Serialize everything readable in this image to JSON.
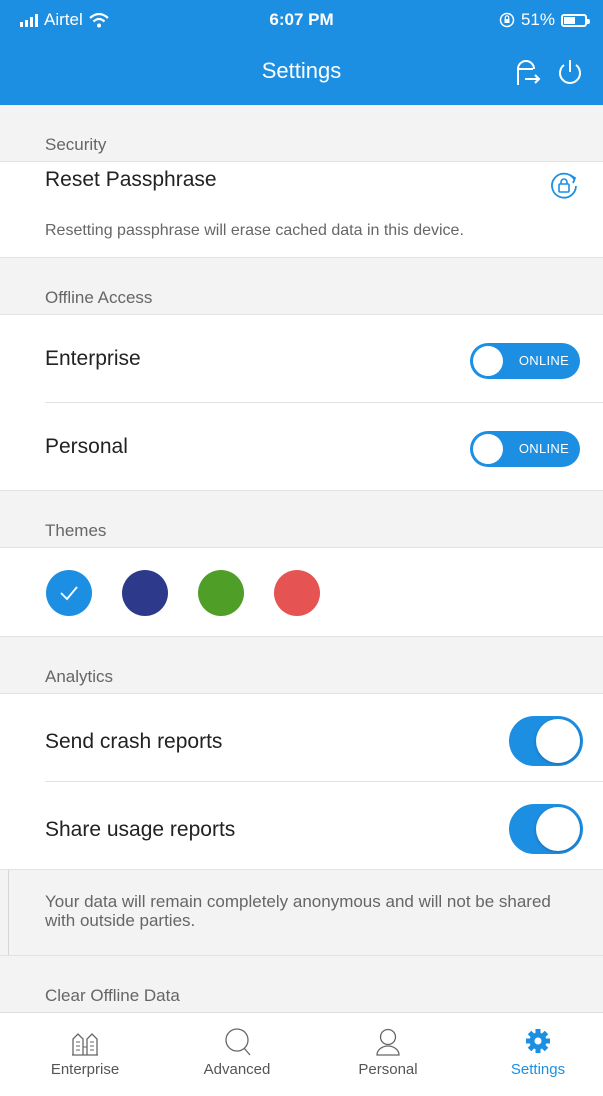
{
  "status_bar": {
    "carrier": "Airtel",
    "time": "6:07 PM",
    "battery": "51%",
    "battery_level": 0.51,
    "icons": [
      "signal-icon",
      "wifi-icon",
      "rotation-lock-icon",
      "battery-icon"
    ]
  },
  "nav": {
    "title": "Settings",
    "icons": [
      "switch-account-icon",
      "power-icon"
    ]
  },
  "security": {
    "header": "Security",
    "reset_label": "Reset Passphrase",
    "reset_icon": "reset-lock-icon",
    "reset_note": "Resetting passphrase will erase cached data in this device."
  },
  "offline_access": {
    "header": "Offline Access",
    "items": [
      {
        "label": "Enterprise",
        "toggle": "ONLINE"
      },
      {
        "label": "Personal",
        "toggle": "ONLINE"
      }
    ]
  },
  "themes": {
    "header": "Themes",
    "colors": [
      "#1d8fe3",
      "#2d3a8c",
      "#4e9e28",
      "#e65353"
    ],
    "selected": 0
  },
  "analytics": {
    "header": "Analytics",
    "items": [
      {
        "label": "Send crash reports",
        "on": true
      },
      {
        "label": "Share usage reports",
        "on": true
      }
    ],
    "note": "Your data will remain completely anonymous and will not be shared with outside parties."
  },
  "clear_offline": {
    "header": "Clear Offline Data"
  },
  "tabbar": {
    "tabs": [
      {
        "label": "Enterprise",
        "icon": "enterprise-icon"
      },
      {
        "label": "Advanced",
        "icon": "search-icon"
      },
      {
        "label": "Personal",
        "icon": "person-icon"
      },
      {
        "label": "Settings",
        "icon": "gear-icon"
      }
    ],
    "active": 3
  },
  "colors": {
    "accent": "#1d8fe3"
  }
}
